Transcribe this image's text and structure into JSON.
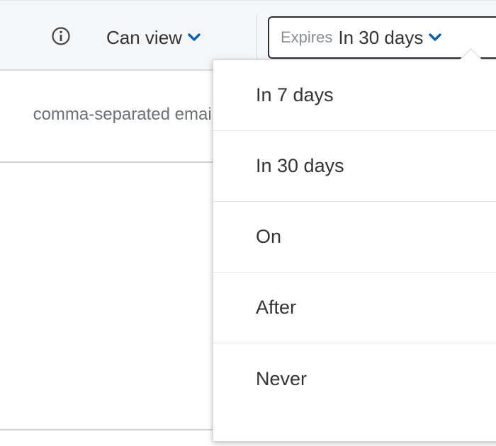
{
  "toolbar": {
    "permission_label": "Can view",
    "expires_prefix": "Expires",
    "expires_value": "In 30 days"
  },
  "form": {
    "email_placeholder": "comma-separated emails"
  },
  "expiry_menu": {
    "items": [
      {
        "label": "In 7 days"
      },
      {
        "label": "In 30 days"
      },
      {
        "label": "On"
      },
      {
        "label": "After"
      },
      {
        "label": "Never"
      }
    ]
  },
  "colors": {
    "accent": "#0e5ea8",
    "text": "#333333",
    "muted": "#6b7075",
    "toolbar_bg": "#f5f6f7"
  },
  "icons": [
    "info-icon",
    "chevron-down-icon"
  ]
}
